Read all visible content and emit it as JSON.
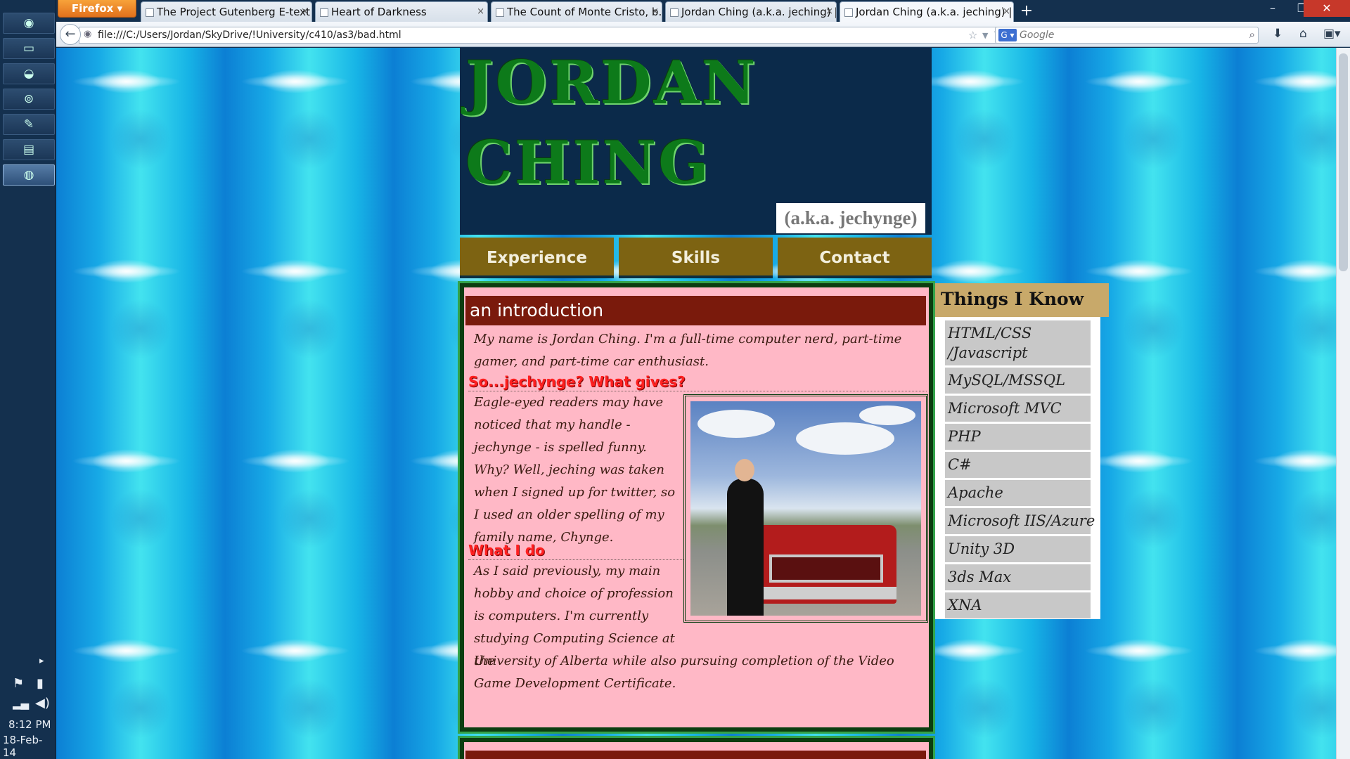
{
  "taskbar": {
    "icons": [
      "chrome-icon",
      "folder-icon",
      "app-icon",
      "steam-icon",
      "brush-icon",
      "document-icon",
      "firefox-icon"
    ],
    "time": "8:12 PM",
    "date": "18-Feb-14"
  },
  "browser": {
    "menu_label": "Firefox",
    "tabs": [
      {
        "label": "The Project Gutenberg E-text ..."
      },
      {
        "label": "Heart of Darkness"
      },
      {
        "label": "The Count of Monte Cristo, b..."
      },
      {
        "label": "Jordan Ching (a.k.a. jeching) | ..."
      },
      {
        "label": "Jordan Ching (a.k.a. jeching) | ..."
      }
    ],
    "url": "file:///C:/Users/Jordan/SkyDrive/!University/c410/as3/bad.html",
    "search_placeholder": "Google"
  },
  "site": {
    "title_line1": "JORDAN",
    "title_line2": "CHING",
    "aka": "(a.k.a. jechynge)",
    "nav": [
      "Experience",
      "Skills",
      "Contact"
    ],
    "intro_heading": "an introduction",
    "intro_text": "My name is Jordan Ching. I'm a full-time computer nerd, part-time gamer, and part-time car enthusiast.",
    "sub1": "So...jechynge? What gives?",
    "sub1_text": "Eagle-eyed readers may have noticed that my handle - jechynge - is spelled funny. Why? Well, jeching was taken when I signed up for twitter, so I used an older spelling of my family name, Chynge.",
    "sub2": "What I do",
    "sub2_text_a": "As I said previously, my main hobby and choice of profession is computers. I'm currently studying Computing Science at the",
    "sub2_text_b": "University of Alberta while also pursuing completion of the Video Game Development Certificate.",
    "sidebar_heading": "Things I Know",
    "skills": [
      "HTML/CSS /Javascript",
      "MySQL/MSSQL",
      "Microsoft MVC",
      "PHP",
      "C#",
      "Apache",
      "Microsoft IIS/Azure",
      "Unity 3D",
      "3ds Max",
      "XNA"
    ]
  }
}
